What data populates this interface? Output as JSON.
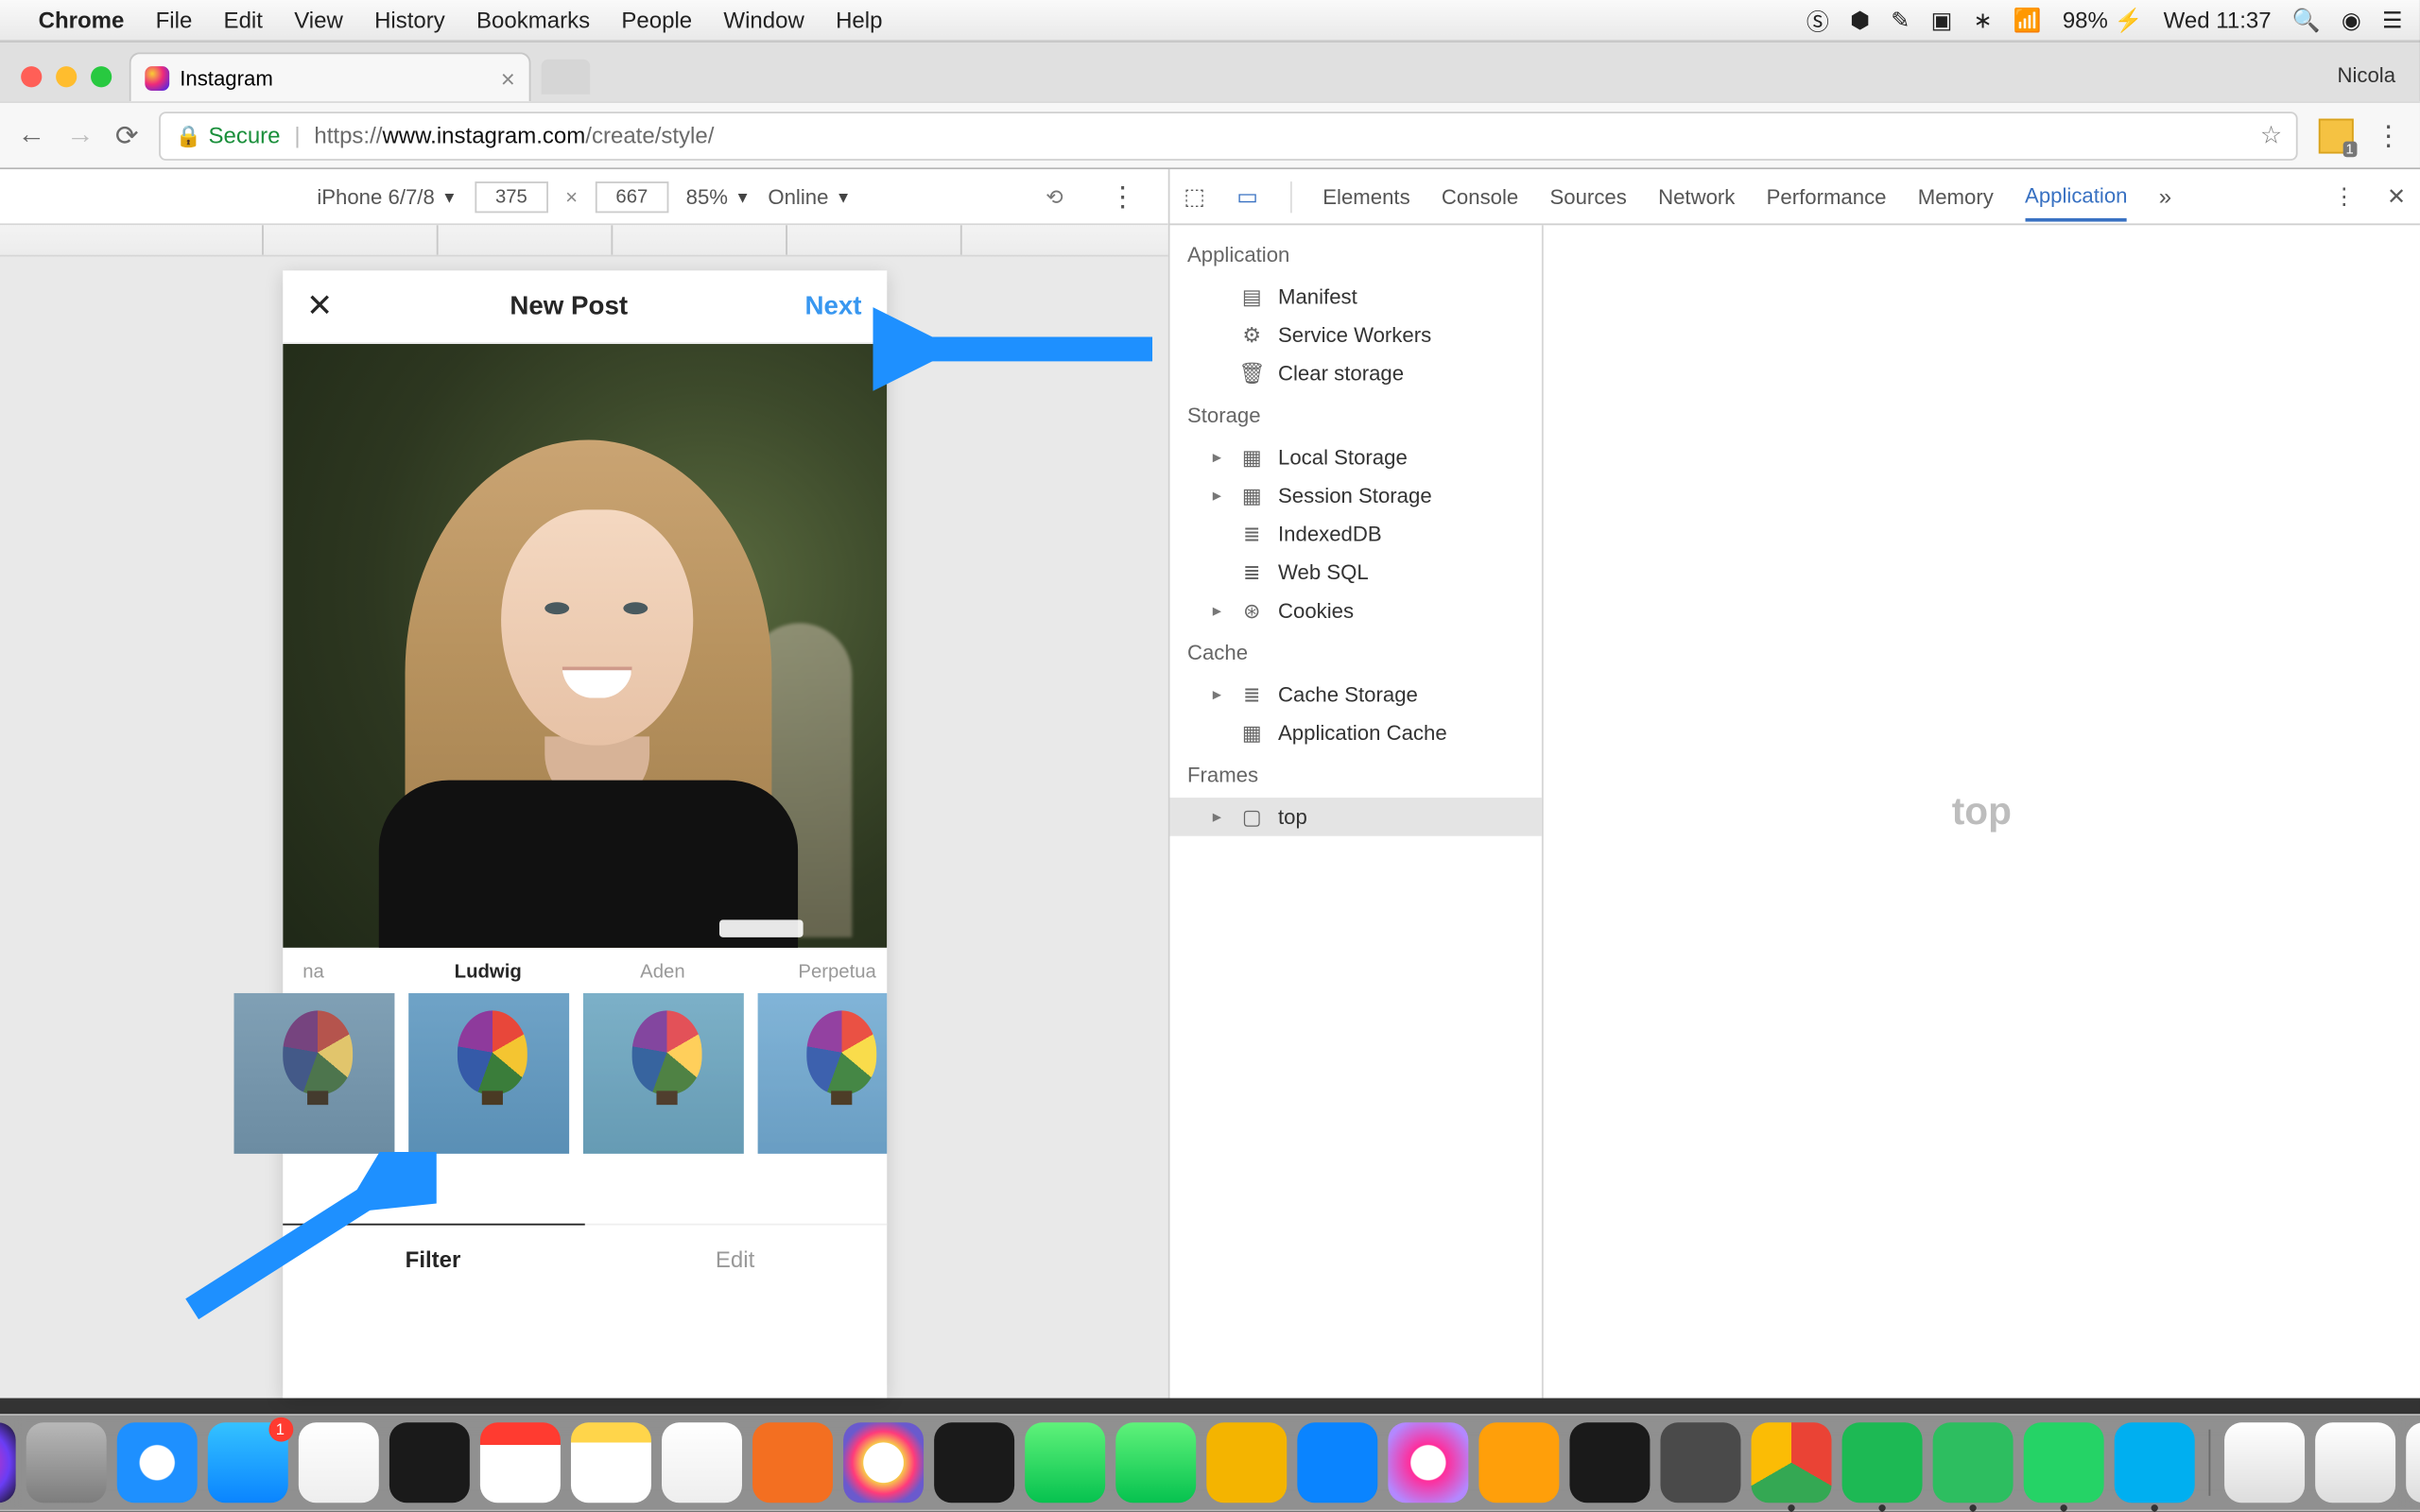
{
  "menubar": {
    "app": "Chrome",
    "items": [
      "File",
      "Edit",
      "View",
      "History",
      "Bookmarks",
      "People",
      "Window",
      "Help"
    ],
    "battery": "98%",
    "clock": "Wed 11:37"
  },
  "chrome": {
    "tabTitle": "Instagram",
    "user": "Nicola",
    "secureLabel": "Secure",
    "url_scheme": "https://",
    "url_host": "www.instagram.com",
    "url_path": "/create/style/"
  },
  "deviceBar": {
    "device": "iPhone 6/7/8",
    "w": "375",
    "h": "667",
    "zoom": "85%",
    "network": "Online"
  },
  "instagram": {
    "title": "New Post",
    "next": "Next",
    "filters": [
      {
        "name": "na",
        "cls": "f-off"
      },
      {
        "name": "Ludwig",
        "cls": "",
        "selected": true
      },
      {
        "name": "Aden",
        "cls": "f-aden"
      },
      {
        "name": "Perpetua",
        "cls": "f-perp"
      }
    ],
    "tabFilter": "Filter",
    "tabEdit": "Edit"
  },
  "devtools": {
    "tabs": [
      "Elements",
      "Console",
      "Sources",
      "Network",
      "Performance",
      "Memory",
      "Application"
    ],
    "activeTab": "Application",
    "mainPlaceholder": "top",
    "side": {
      "application": {
        "hdr": "Application",
        "items": [
          {
            "icon": "file",
            "label": "Manifest"
          },
          {
            "icon": "gear",
            "label": "Service Workers"
          },
          {
            "icon": "trash",
            "label": "Clear storage"
          }
        ]
      },
      "storage": {
        "hdr": "Storage",
        "items": [
          {
            "icon": "grid",
            "label": "Local Storage",
            "arrow": true
          },
          {
            "icon": "grid",
            "label": "Session Storage",
            "arrow": true
          },
          {
            "icon": "db",
            "label": "IndexedDB"
          },
          {
            "icon": "db",
            "label": "Web SQL"
          },
          {
            "icon": "cookie",
            "label": "Cookies",
            "arrow": true
          }
        ]
      },
      "cache": {
        "hdr": "Cache",
        "items": [
          {
            "icon": "db",
            "label": "Cache Storage",
            "arrow": true
          },
          {
            "icon": "grid",
            "label": "Application Cache"
          }
        ]
      },
      "frames": {
        "hdr": "Frames",
        "items": [
          {
            "icon": "frame",
            "label": "top",
            "arrow": true,
            "selected": true
          }
        ]
      }
    }
  },
  "dock": {
    "items": [
      {
        "name": "finder",
        "bg": "linear-gradient(#3ab0ff,#0d6fd6)",
        "running": true
      },
      {
        "name": "siri",
        "bg": "radial-gradient(circle,#ff2d9b,#6a3df5 60%,#111)"
      },
      {
        "name": "launchpad",
        "bg": "linear-gradient(#b8b8b8,#7d7d7d)"
      },
      {
        "name": "safari",
        "bg": "radial-gradient(circle,#fff 30%,#1e90ff 32%)"
      },
      {
        "name": "appstore",
        "bg": "linear-gradient(#34c2ff,#0a84ff)",
        "badge": "1"
      },
      {
        "name": "preview",
        "bg": "linear-gradient(#fff,#eee)"
      },
      {
        "name": "1password",
        "bg": "#1a1a1a"
      },
      {
        "name": "calendar",
        "bg": "linear-gradient(#ff3b30 0 28%,#fff 28%)"
      },
      {
        "name": "notes",
        "bg": "linear-gradient(#ffd54a 0 25%,#fff 25%)"
      },
      {
        "name": "numbers",
        "bg": "linear-gradient(#fff,#eee)"
      },
      {
        "name": "harvest",
        "bg": "#f36f21"
      },
      {
        "name": "photos",
        "bg": "radial-gradient(circle,#fff 35%,#f7c94a 36%,#ff3b7b 55%,#6a5acd 75%)"
      },
      {
        "name": "timer",
        "bg": "#1a1a1a"
      },
      {
        "name": "messages",
        "bg": "linear-gradient(#5ff27a,#06c24f)"
      },
      {
        "name": "facetime",
        "bg": "linear-gradient(#5ff27a,#06c24f)"
      },
      {
        "name": "slides",
        "bg": "#f4b400"
      },
      {
        "name": "keynote",
        "bg": "#0a84ff"
      },
      {
        "name": "itunes",
        "bg": "radial-gradient(circle,#fff 30%,#ff2d9b 32%,#b388ff 80%)"
      },
      {
        "name": "ibooks",
        "bg": "#ff9f0a"
      },
      {
        "name": "terminal",
        "bg": "#1a1a1a"
      },
      {
        "name": "sublime",
        "bg": "#4a4a4a"
      },
      {
        "name": "chrome",
        "bg": "conic-gradient(#ea4335 0 120deg,#34a853 120deg 240deg,#fbbc05 240deg 360deg)",
        "running": true
      },
      {
        "name": "spotify",
        "bg": "#1db954",
        "running": true
      },
      {
        "name": "evernote",
        "bg": "#2dbe60",
        "running": true
      },
      {
        "name": "whatsapp",
        "bg": "#25d366",
        "running": true
      },
      {
        "name": "skype",
        "bg": "#00aff0",
        "running": true
      }
    ],
    "afterSep": [
      {
        "name": "doc1",
        "bg": "linear-gradient(#fff,#ddd)"
      },
      {
        "name": "doc2",
        "bg": "linear-gradient(#fff,#ddd)"
      },
      {
        "name": "doc3",
        "bg": "linear-gradient(#fff,#ddd)"
      },
      {
        "name": "trash",
        "bg": "radial-gradient(circle,#e0e0e0,#bcbcbc)"
      }
    ]
  }
}
